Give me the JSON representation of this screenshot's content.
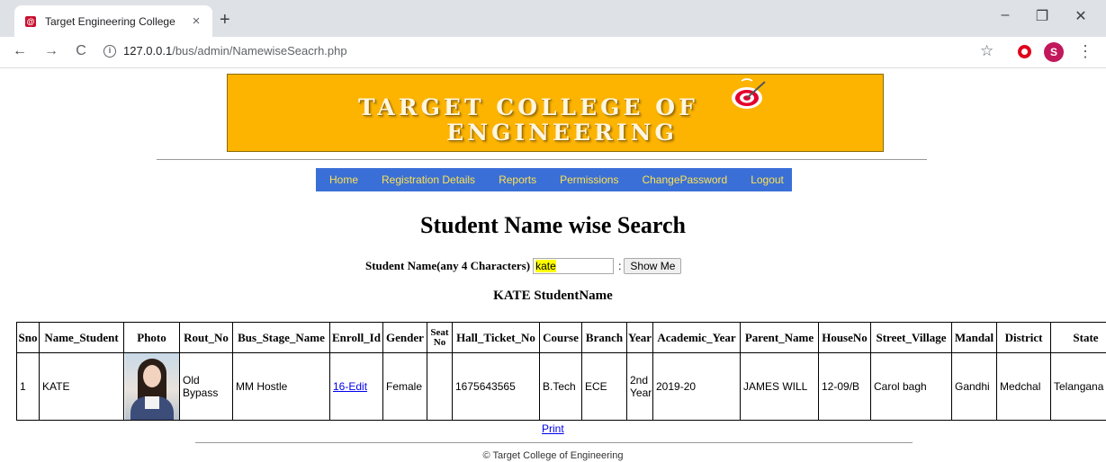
{
  "browser": {
    "tab_title": "Target Engineering College",
    "favicon_letter": "@",
    "tab_close": "×",
    "new_tab": "+",
    "url_host": "127.0.0.1",
    "url_path": "/bus/admin/NamewiseSeacrh.php",
    "avatar_letter": "S",
    "minimize": "–",
    "restore": "❐",
    "close": "✕"
  },
  "banner": {
    "line1": "TARGET COLLEGE OF",
    "line2": "ENGINEERING"
  },
  "menu": {
    "items": [
      "Home",
      "Registration Details",
      "Reports",
      "Permissions",
      "ChangePassword",
      "Logout"
    ]
  },
  "page": {
    "heading": "Student Name wise Search",
    "search_label": "Student Name(any 4 Characters)",
    "search_value": "kate",
    "search_separator": ":",
    "show_button": "Show Me",
    "result_heading": "KATE StudentName",
    "print_label": "Print",
    "footer": "© Target College of Engineering"
  },
  "table": {
    "headers": [
      "Sno",
      "Name_Student",
      "Photo",
      "Rout_No",
      "Bus_Stage_Name",
      "Enroll_Id",
      "Gender",
      "Seat No",
      "Hall_Ticket_No",
      "Course",
      "Branch",
      "Year",
      "Academic_Year",
      "Parent_Name",
      "HouseNo",
      "Street_Village",
      "Mandal",
      "District",
      "State"
    ],
    "row": {
      "sno": "1",
      "name": "KATE",
      "rout_no": "Old Bypass",
      "bus_stage": "MM Hostle",
      "enroll_id": "16-Edit",
      "gender": "Female",
      "seat_no": "",
      "hall_ticket": "1675643565",
      "course": "B.Tech",
      "branch": "ECE",
      "year": "2nd Year",
      "academic_year": "2019-20",
      "parent_name": "JAMES WILL",
      "house_no": "12-09/B",
      "street_village": "Carol bagh",
      "mandal": "Gandhi",
      "district": "Medchal",
      "state": "Telangana"
    }
  }
}
